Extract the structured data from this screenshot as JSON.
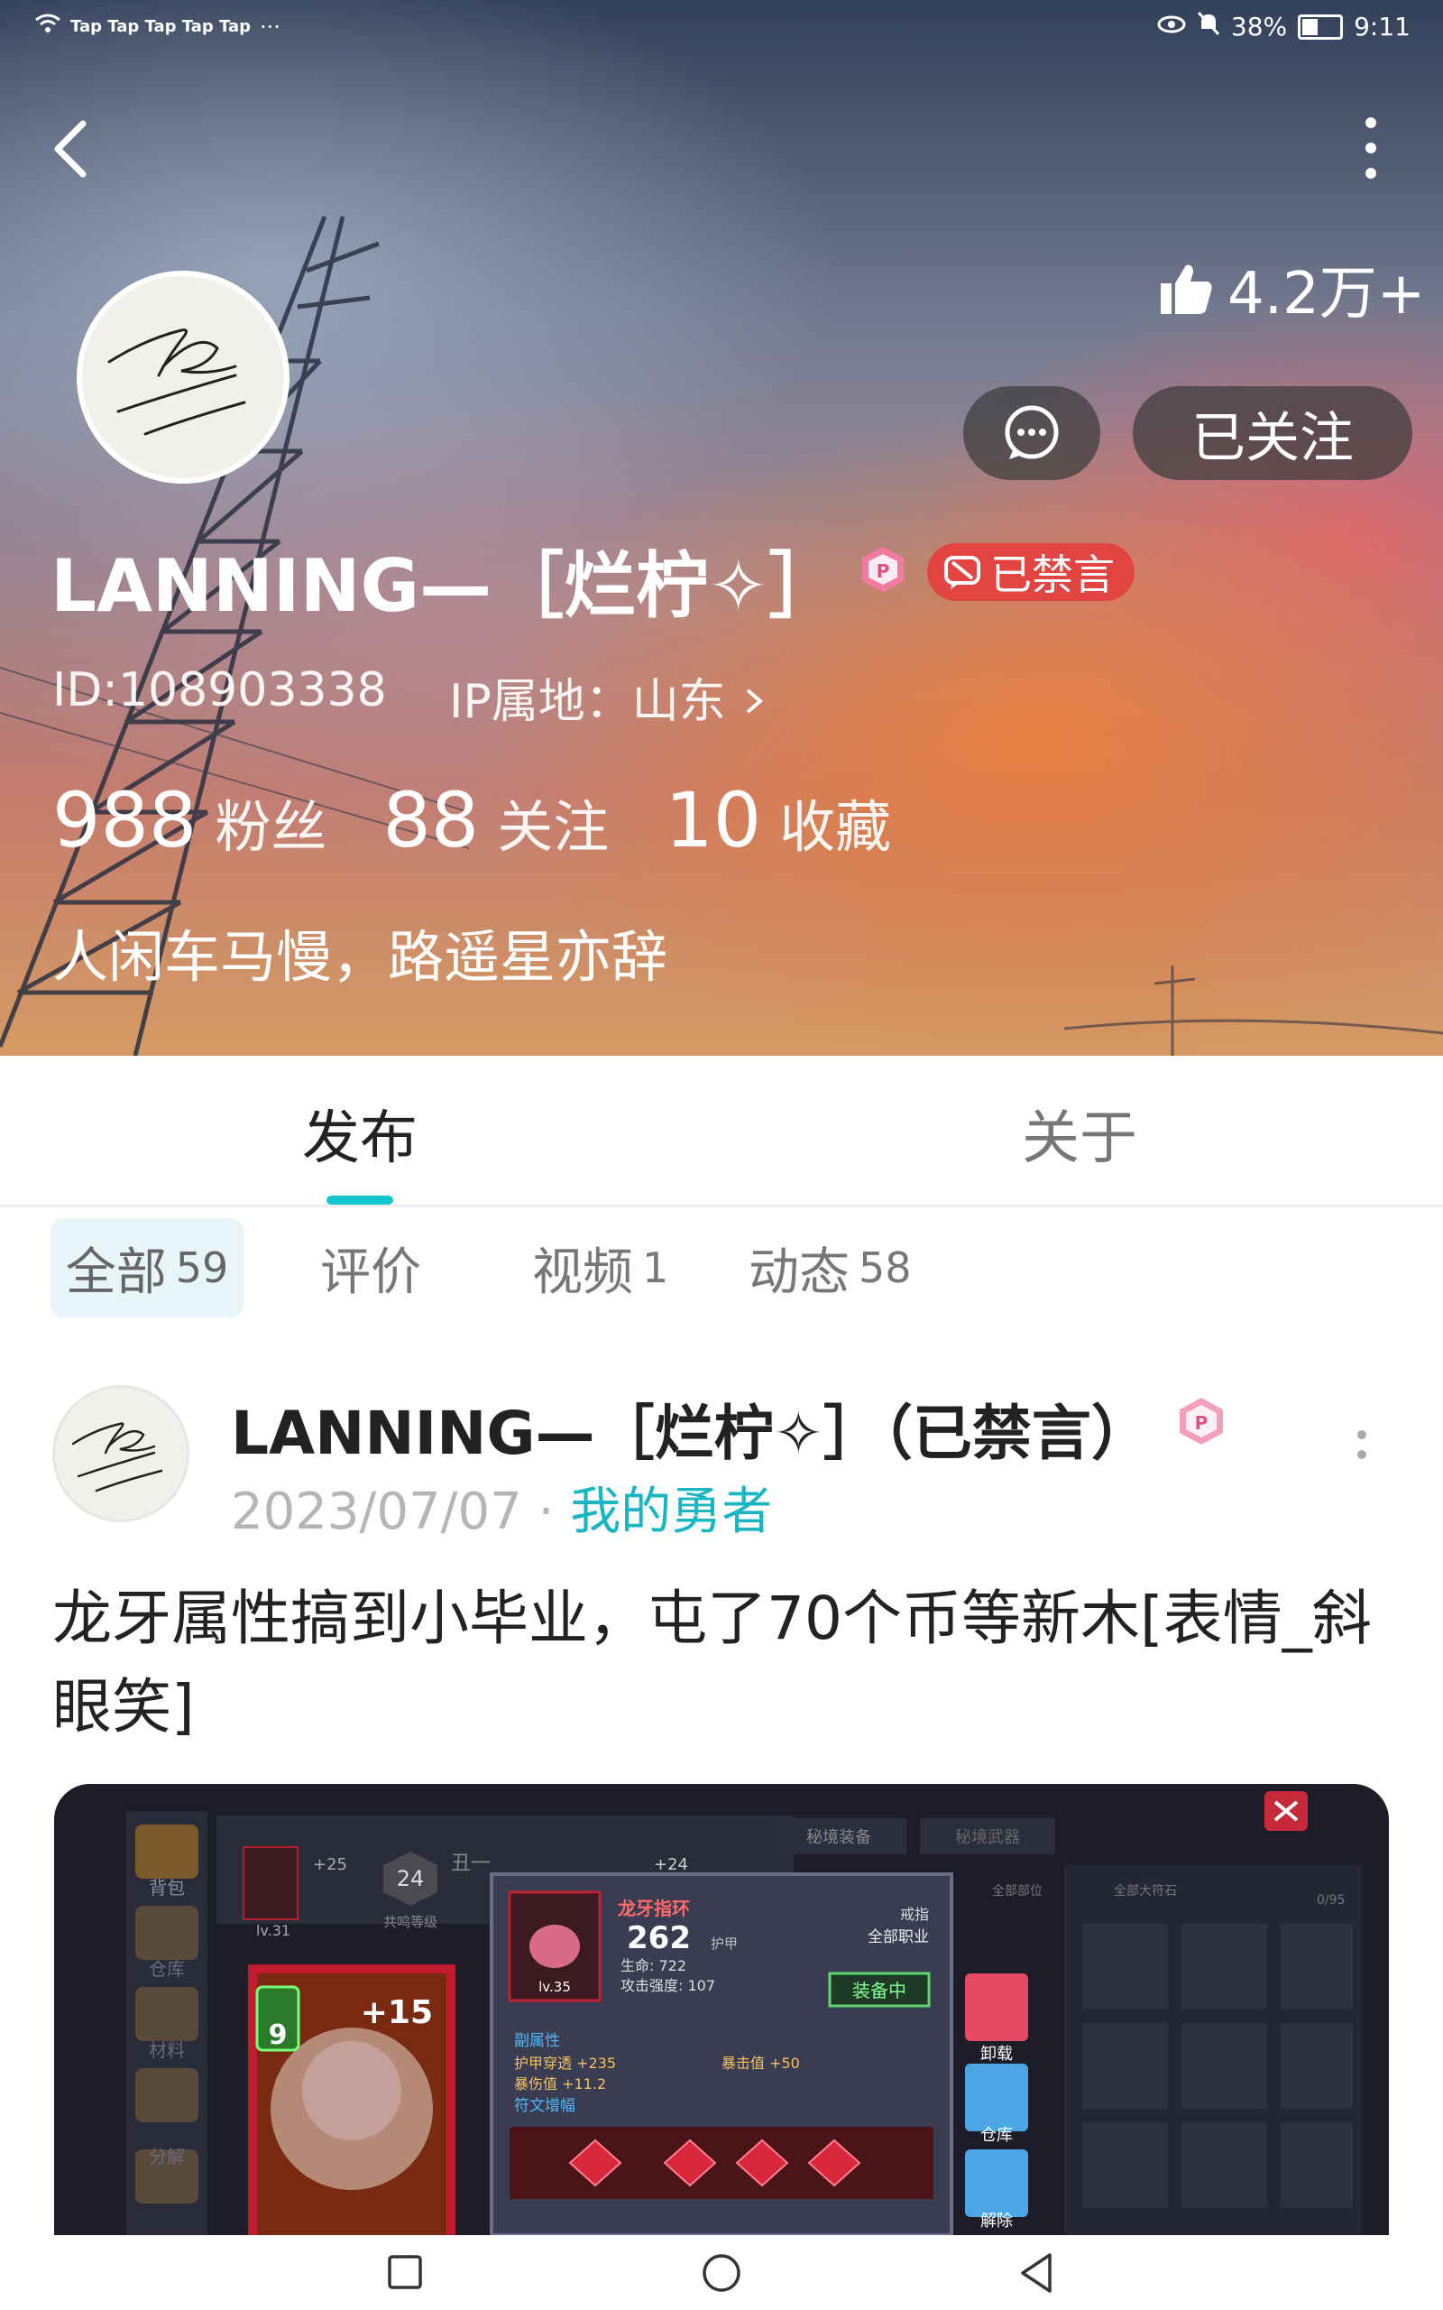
{
  "status_bar": {
    "carriers": "Tap Tap Tap Tap Tap",
    "overflow": "···",
    "battery": "38%",
    "time": "9:11"
  },
  "profile": {
    "likes": "4.2万+",
    "follow_label": "已关注",
    "name": "LANNING—［烂柠✧］",
    "banned_label": "已禁言",
    "id_text": "ID:108903338",
    "ip_text": "IP属地：山东",
    "stats": [
      {
        "num": "988",
        "label": "粉丝"
      },
      {
        "num": "88",
        "label": "关注"
      },
      {
        "num": "10",
        "label": "收藏"
      }
    ],
    "bio": "人闲车马慢，路遥星亦辞"
  },
  "tabs": [
    {
      "label": "发布",
      "active": true
    },
    {
      "label": "关于",
      "active": false
    }
  ],
  "subtabs": [
    {
      "label": "全部",
      "count": "59"
    },
    {
      "label": "评价",
      "count": ""
    },
    {
      "label": "视频",
      "count": "1"
    },
    {
      "label": "动态",
      "count": "58"
    }
  ],
  "post": {
    "author": "LANNING—［烂柠✧］（已禁言）",
    "date": "2023/07/07",
    "sep": "·",
    "game": "我的勇者",
    "text": "龙牙属性搞到小毕业，屯了70个币等新木[表情_斜眼笑]",
    "image": {
      "item_name": "龙牙指环",
      "item_type": "戒指",
      "item_class": "全部职业",
      "armor_value": "262",
      "armor_label": "护甲",
      "hp": "生命: 722",
      "atk": "攻击强度: 107",
      "equipped": "装备中",
      "level": "lv.35",
      "sub_attr": "副属性",
      "attr1": "护甲穿透 +235",
      "attr2": "暴击值 +50",
      "attr3": "暴伤值 +11.2",
      "rune": "符文增幅",
      "hero_plus": "+15",
      "hero_lv": "9",
      "tab1": "秘境装备",
      "tab2": "秘境武器",
      "side1": "背包",
      "side2": "仓库",
      "side3": "材料",
      "side4": "分解",
      "act1": "卸载",
      "act2": "仓库",
      "act3": "解除",
      "filter1": "全部部位",
      "filter2": "全部大符石",
      "slots": "0/95",
      "pet_plus": "+25",
      "pet_lv": "lv.31",
      "shared_lv": "24",
      "shared_label": "共鸣等级",
      "name_small": "丑一",
      "plus24": "+24"
    }
  },
  "colors": {
    "accent": "#15c5ce",
    "banned": "#e24441",
    "game_link": "#18b6c2"
  }
}
